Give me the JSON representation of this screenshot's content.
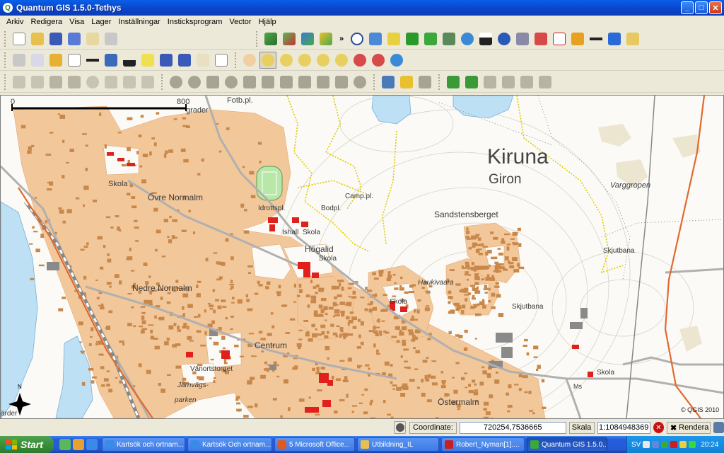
{
  "window": {
    "title": "Quantum GIS 1.5.0-Tethys"
  },
  "menu": [
    "Arkiv",
    "Redigera",
    "Visa",
    "Lager",
    "Inställningar",
    "Insticksprogram",
    "Vector",
    "Hjälp"
  ],
  "toolbar_overflow": "»",
  "map": {
    "scale_bar": {
      "start": "0",
      "end": "800",
      "unit": "grader"
    },
    "labels": {
      "fotb": "Fotb.pl.",
      "kiruna": "Kiruna",
      "giron": "Giron",
      "varggropen": "Varggropen",
      "skola1": "Skola",
      "ovre": "Övre Normalm",
      "camp": "Camp.pl.",
      "idrott": "Idrottspl.",
      "bodpl": "Bodpl.",
      "sandstens": "Sandstensberget",
      "ishall": "Ishall",
      "skola2": "Skola",
      "hogalid": "Högalid",
      "skola3": "Skola",
      "skjutbana1": "Skjutbana",
      "haukivaara": "Haukivaara",
      "nedre": "Nedre Normalm",
      "skola4": "Skola",
      "skjutbana2": "Skjutbana",
      "centrum": "Centrum",
      "vanort": "Vänortstorget",
      "skola5": "Skola",
      "ms": "Ms",
      "jarnvags": "Järnvägs-",
      "parken": "parken",
      "ostermalm": "Östermalm",
      "arder": "ärder",
      "north": "N",
      "copyright": "© QGIS 2010"
    }
  },
  "status": {
    "coordinate_label": "Coordinate:",
    "coordinate_value": "720254,7536665",
    "scale_label": "Skala",
    "scale_value": "1:1084948369",
    "render_label": "Rendera"
  },
  "taskbar": {
    "start": "Start",
    "tasks": [
      "Kartsök och ortnam...",
      "Kartsök Och ortnam...",
      "5 Microsoft Office...",
      "Utbildning_IL",
      "Robert_Nyman[1]....",
      "Quantum GIS 1.5.0...."
    ],
    "lang": "SV",
    "clock": "20:24"
  }
}
